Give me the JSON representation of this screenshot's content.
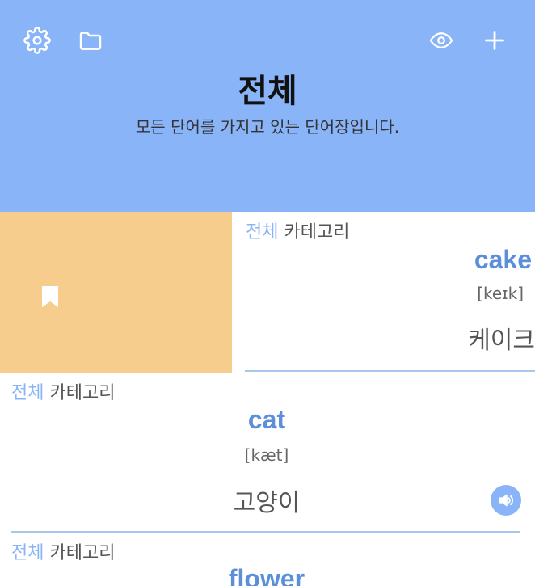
{
  "header": {
    "title": "전체",
    "subtitle": "모든 단어를 가지고 있는 단어장입니다.",
    "icons": [
      "gear-icon",
      "folder-icon",
      "eye-icon",
      "plus-icon"
    ]
  },
  "colors": {
    "header_bg": "#8ab4f8",
    "swipe_bg": "#f7cd8e",
    "accent": "#5b8fd9"
  },
  "cards": [
    {
      "category_prefix": "전체",
      "category_label": "카테고리",
      "word": "cake",
      "pronunciation": "[keɪk]",
      "meaning": "케이크"
    },
    {
      "category_prefix": "전체",
      "category_label": "카테고리",
      "word": "cat",
      "pronunciation": "[kæt]",
      "meaning": "고양이"
    },
    {
      "category_prefix": "전체",
      "category_label": "카테고리",
      "word": "flower"
    }
  ]
}
